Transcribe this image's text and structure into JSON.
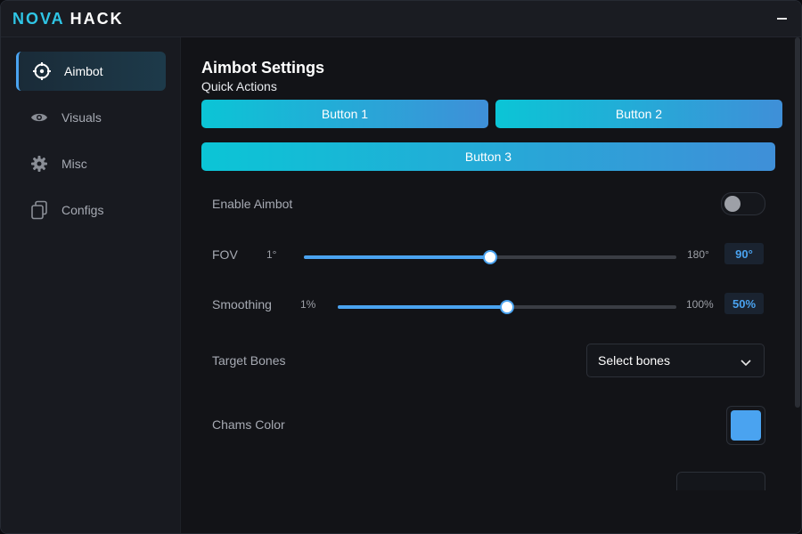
{
  "app": {
    "logo_part1": "NOVA",
    "logo_part2": "HACK"
  },
  "colors": {
    "accent": "#4aa3f0",
    "button_gradient_start": "#0bc5d6",
    "button_gradient_end": "#3f8fd8",
    "chams_color": "#4aa3f0"
  },
  "sidebar": {
    "items": [
      {
        "label": "Aimbot",
        "icon": "crosshair-icon",
        "active": true
      },
      {
        "label": "Visuals",
        "icon": "eye-icon",
        "active": false
      },
      {
        "label": "Misc",
        "icon": "gear-icon",
        "active": false
      },
      {
        "label": "Configs",
        "icon": "copy-icon",
        "active": false
      }
    ]
  },
  "main": {
    "title": "Aimbot Settings",
    "subtitle": "Quick Actions",
    "buttons": [
      "Button 1",
      "Button 2",
      "Button 3"
    ],
    "enable_aimbot": {
      "label": "Enable Aimbot",
      "enabled": false
    },
    "fov": {
      "label": "FOV",
      "min_label": "1°",
      "max_label": "180°",
      "value": "90°",
      "fraction": 0.5
    },
    "smoothing": {
      "label": "Smoothing",
      "min_label": "1%",
      "max_label": "100%",
      "value": "50%",
      "fraction": 0.5
    },
    "target_bones": {
      "label": "Target Bones",
      "placeholder": "Select bones"
    },
    "chams_color": {
      "label": "Chams Color"
    }
  }
}
